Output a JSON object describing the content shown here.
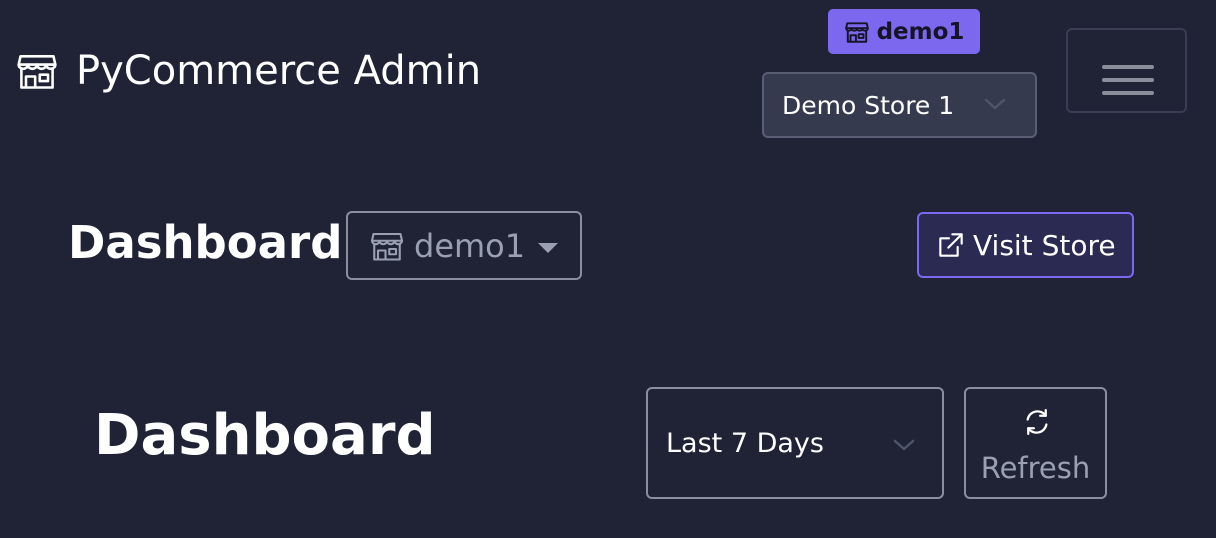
{
  "brand": {
    "title": "PyCommerce Admin",
    "icon": "store-icon"
  },
  "store_badge": {
    "label": "demo1",
    "icon": "store-icon",
    "color": "#7b68ee"
  },
  "store_select": {
    "value": "Demo Store 1",
    "icon": "chevron-down-icon"
  },
  "nav_toggle": {
    "icon": "hamburger-menu-icon"
  },
  "dashboard_header": {
    "title": "Dashboard",
    "store_dropdown": {
      "label": "demo1",
      "icon": "store-icon"
    },
    "visit_store": {
      "label": "Visit Store",
      "icon": "external-link-icon",
      "accent": "#7b68ee"
    }
  },
  "dashboard_main": {
    "title": "Dashboard",
    "period_select": {
      "value": "Last 7 Days",
      "icon": "chevron-down-icon"
    },
    "refresh": {
      "label": "Refresh",
      "icon": "refresh-icon"
    }
  },
  "colors": {
    "background": "#1f2335",
    "accent": "#7b68ee"
  }
}
